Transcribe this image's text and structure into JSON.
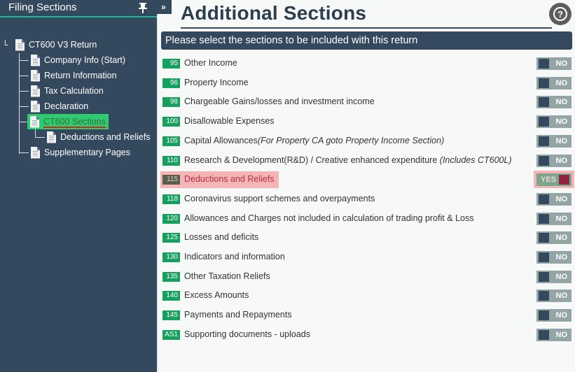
{
  "sidebar": {
    "title": "Filing Sections",
    "pin_icon": "pin-icon",
    "collapse_label": "»",
    "tree": {
      "root": "CT600 V3 Return",
      "items": [
        {
          "label": "Company Info (Start)"
        },
        {
          "label": "Return Information"
        },
        {
          "label": "Tax Calculation"
        },
        {
          "label": "Declaration"
        },
        {
          "label": "CT600 Sections",
          "selected": true,
          "children": [
            {
              "label": "Deductions and Reliefs"
            }
          ]
        },
        {
          "label": "Supplementary Pages"
        }
      ]
    }
  },
  "main": {
    "title": "Additional Sections",
    "help_label": "?",
    "banner": "Please select the sections to be included with this return",
    "toggle_on_label": "YES",
    "toggle_off_label": "NO",
    "colors": {
      "badge": "#16a05d",
      "header": "#34495e",
      "highlight": "#f6b4b7",
      "accent": "#1abc9c"
    },
    "sections": [
      {
        "code": "95",
        "label": "Other Income",
        "note": "",
        "enabled": false
      },
      {
        "code": "96",
        "label": "Property Income",
        "note": "",
        "enabled": false
      },
      {
        "code": "98",
        "label": "Chargeable Gains/losses and investment income",
        "note": "",
        "enabled": false
      },
      {
        "code": "100",
        "label": "Disallowable Expenses",
        "note": "",
        "enabled": false
      },
      {
        "code": "105",
        "label": "Capital Allowances",
        "note": "(For Property CA goto Property Income Section)",
        "enabled": false
      },
      {
        "code": "110",
        "label": "Research & Development(R&D) / Creative enhanced expenditure ",
        "note": "(Includes CT600L)",
        "enabled": false
      },
      {
        "code": "115",
        "label": "Deductions and Reliefs",
        "note": "",
        "enabled": true
      },
      {
        "code": "118",
        "label": "Coronavirus support schemes and overpayments",
        "note": "",
        "enabled": false
      },
      {
        "code": "120",
        "label": "Allowances and Charges not included in calculation of trading profit & Loss",
        "note": "",
        "enabled": false
      },
      {
        "code": "125",
        "label": "Losses and deficits",
        "note": "",
        "enabled": false
      },
      {
        "code": "130",
        "label": "Indicators and information",
        "note": "",
        "enabled": false
      },
      {
        "code": "135",
        "label": "Other Taxation Reliefs",
        "note": "",
        "enabled": false
      },
      {
        "code": "140",
        "label": "Excess Amounts",
        "note": "",
        "enabled": false
      },
      {
        "code": "145",
        "label": "Payments and Repayments",
        "note": "",
        "enabled": false
      },
      {
        "code": "AS1",
        "label": "Supporting documents - uploads",
        "note": "",
        "enabled": false
      }
    ]
  }
}
